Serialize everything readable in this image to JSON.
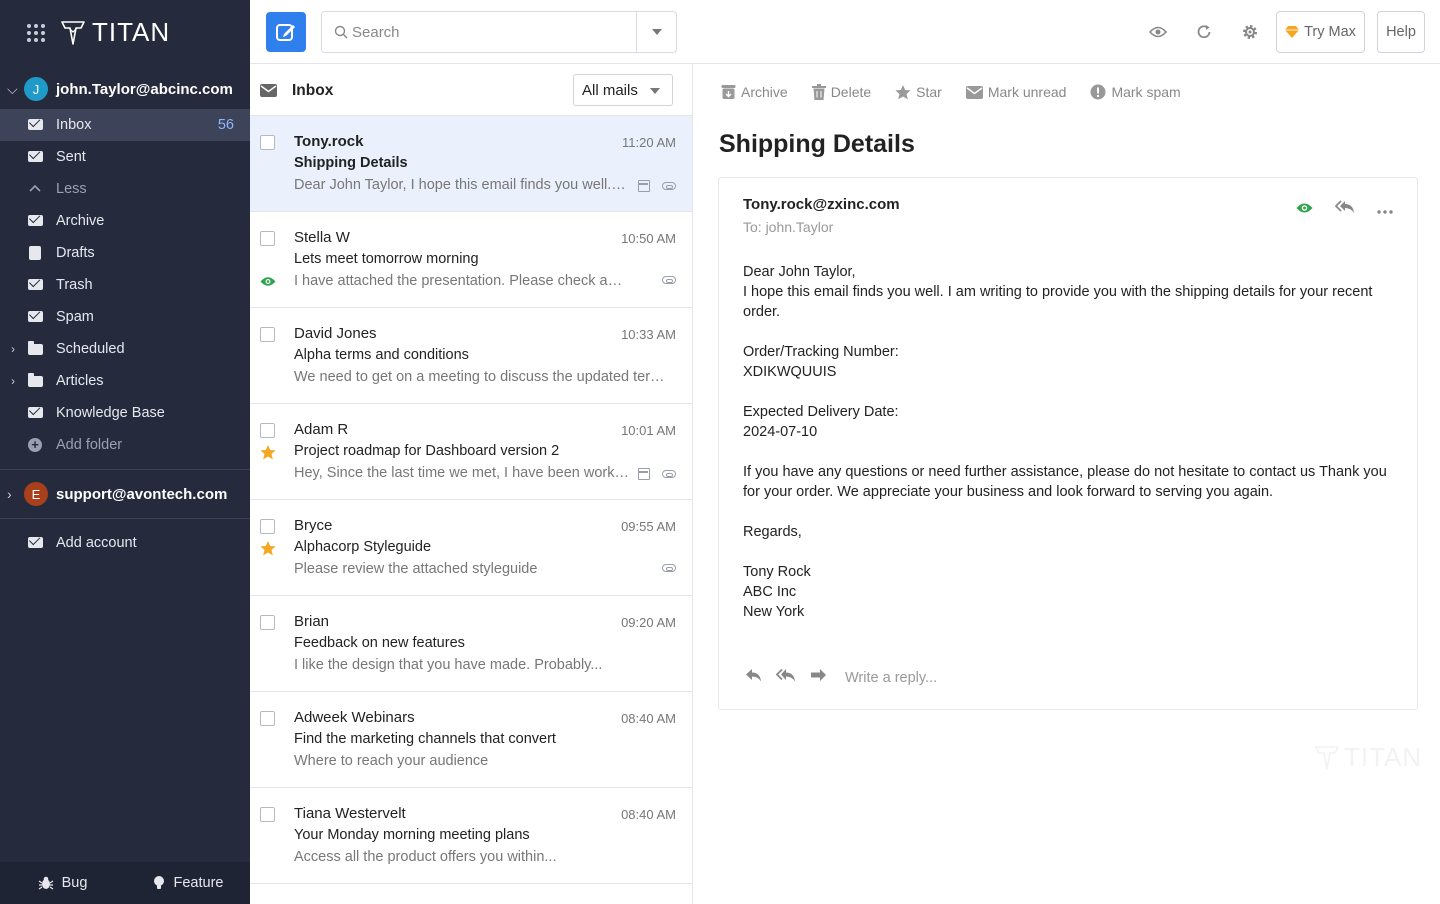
{
  "brand": {
    "logo_text": "TITAN"
  },
  "accounts": [
    {
      "initial": "J",
      "email": "john.Taylor@abcinc.com",
      "color": "#1f9ac9"
    },
    {
      "initial": "E",
      "email": "support@avontech.com",
      "color": "#a8401c"
    }
  ],
  "folders": [
    {
      "label": "Inbox",
      "count": "56"
    },
    {
      "label": "Sent"
    },
    {
      "label": "Less"
    },
    {
      "label": "Archive"
    },
    {
      "label": "Drafts"
    },
    {
      "label": "Trash"
    },
    {
      "label": "Spam"
    },
    {
      "label": "Scheduled"
    },
    {
      "label": "Articles"
    },
    {
      "label": "Knowledge Base"
    },
    {
      "label": "Add folder"
    }
  ],
  "add_account": "Add account",
  "footer": {
    "bug": "Bug",
    "feature": "Feature"
  },
  "search": {
    "placeholder": "Search"
  },
  "toolbar": {
    "try_max": "Try Max",
    "help": "Help"
  },
  "list": {
    "title": "Inbox",
    "filter": "All mails",
    "items": [
      {
        "sender": "Tony.rock",
        "time": "11:20 AM",
        "subject": "Shipping Details",
        "preview": "Dear John Taylor, I hope this email finds you well. I am writing to provide you with the shipping details"
      },
      {
        "sender": "Stella W",
        "time": "10:50 AM",
        "subject": "Lets meet tomorrow morning",
        "preview": "I have attached the presentation. Please check and let me know"
      },
      {
        "sender": "David Jones",
        "time": "10:33 AM",
        "subject": "Alpha terms and conditions",
        "preview": "We need to get on a meeting to discuss the updated terms and conditions"
      },
      {
        "sender": "Adam R",
        "time": "10:01 AM",
        "subject": "Project roadmap for Dashboard version 2",
        "preview": "Hey, Since the last time we met, I have been working on the roadmap"
      },
      {
        "sender": "Bryce",
        "time": "09:55 AM",
        "subject": "Alphacorp Styleguide",
        "preview": "Please review the attached styleguide"
      },
      {
        "sender": "Brian",
        "time": "09:20 AM",
        "subject": "Feedback on new features",
        "preview": "I like the design that you have made. Probably..."
      },
      {
        "sender": "Adweek Webinars",
        "time": "08:40 AM",
        "subject": "Find the marketing channels that convert",
        "preview": "Where to reach your audience"
      },
      {
        "sender": "Tiana Westervelt",
        "time": "08:40 AM",
        "subject": "Your Monday morning meeting plans",
        "preview": "Access all the product offers you within..."
      }
    ]
  },
  "reader": {
    "actions": {
      "archive": "Archive",
      "delete": "Delete",
      "star": "Star",
      "mark_unread": "Mark unread",
      "mark_spam": "Mark spam"
    },
    "title": "Shipping Details",
    "from": "Tony.rock@zxinc.com",
    "to": "To: john.Taylor",
    "body": {
      "greeting": "Dear John Taylor,",
      "intro": "I hope this email finds you well. I am writing to provide you with the shipping details for your recent order.",
      "tracking_label": "Order/Tracking Number:",
      "tracking_value": "XDIKWQUUIS",
      "delivery_label": "Expected Delivery Date:",
      "delivery_value": "2024-07-10",
      "closing": "If you have any questions or need further assistance, please do not hesitate to contact us Thank you for your order. We appreciate your business and look forward to serving you again.",
      "regards": "Regards,",
      "sig_name": "Tony Rock",
      "sig_company": "ABC Inc",
      "sig_city": "New York"
    },
    "reply_placeholder": "Write a reply..."
  },
  "watermark": "TITAN",
  "colors": {
    "accent": "#2f80ed",
    "sidebar": "#252b3d",
    "star": "#f5a623",
    "seen": "#2ea44f"
  }
}
